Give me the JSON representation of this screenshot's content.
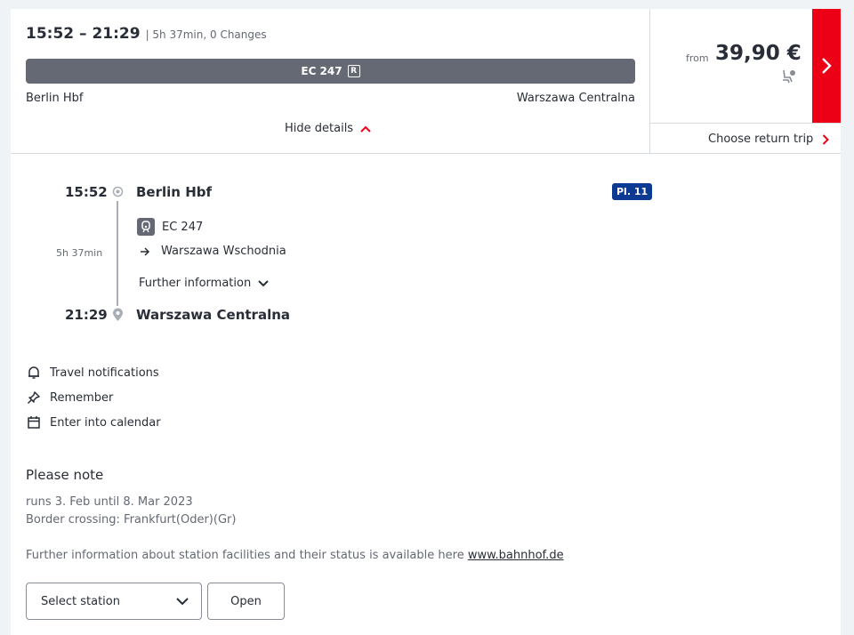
{
  "summary": {
    "time_range": "15:52 – 21:29",
    "meta": "| 5h 37min, 0 Changes",
    "train": "EC 247",
    "reservation_badge": "R",
    "from_station": "Berlin Hbf",
    "to_station": "Warszawa Centralna",
    "hide_details": "Hide details"
  },
  "price": {
    "from_label": "from",
    "value": "39,90 €",
    "return_trip": "Choose return trip"
  },
  "details": {
    "dep_time": "15:52",
    "dep_station": "Berlin Hbf",
    "platform": "Pl. 11",
    "duration": "5h 37min",
    "train": "EC 247",
    "direction": "Warszawa Wschodnia",
    "further_info": "Further information",
    "arr_time": "21:29",
    "arr_station": "Warszawa Centralna"
  },
  "actions": {
    "notifications": "Travel notifications",
    "remember": "Remember",
    "calendar": "Enter into calendar"
  },
  "note": {
    "title": "Please note",
    "line1": "runs 3. Feb until 8. Mar 2023",
    "line2": "Border crossing: Frankfurt(Oder)(Gr)",
    "facilities": "Further information about station facilities and their status is available here",
    "link": "www.bahnhof.de"
  },
  "station_select": {
    "value": "Select station",
    "open_label": "Open"
  },
  "colors": {
    "accent_red": "#ec0016",
    "train_bar": "#646973",
    "platform_badge": "#0c3992",
    "text": "#282d37"
  },
  "icons": [
    "chevron-up-icon",
    "chevron-right-icon",
    "seat-icon",
    "departure-circle-icon",
    "location-pin-icon",
    "train-icon",
    "arrow-right-icon",
    "chevron-down-icon",
    "bell-icon",
    "pin-icon",
    "calendar-icon"
  ]
}
